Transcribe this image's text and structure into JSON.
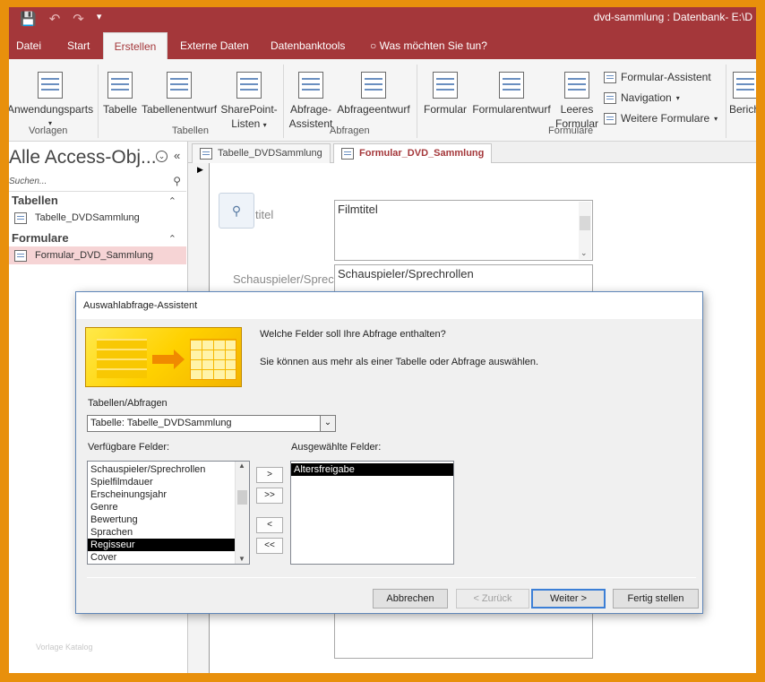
{
  "window": {
    "title": "dvd-sammlung : Datenbank- E:\\D"
  },
  "ribbon_tabs": [
    {
      "label": "Datei"
    },
    {
      "label": "Start"
    },
    {
      "label": "Erstellen"
    },
    {
      "label": "Externe Daten"
    },
    {
      "label": "Datenbanktools"
    },
    {
      "label": "Was möchten Sie tun?"
    }
  ],
  "ribbon": {
    "groups": {
      "vorlagen": "Vorlagen",
      "tabellen": "Tabellen",
      "abfragen": "Abfragen",
      "formulare": "Formulare"
    },
    "buttons": {
      "anwendungsparts": "Anwendungsparts",
      "tabelle": "Tabelle",
      "tabellenentwurf": "Tabellenentwurf",
      "sharepoint_1": "SharePoint-",
      "sharepoint_2": "Listen",
      "abfrage_assistent_1": "Abfrage-",
      "abfrage_assistent_2": "Assistent",
      "abfrageentwurf": "Abfrageentwurf",
      "formular": "Formular",
      "formularentwurf": "Formularentwurf",
      "leeres_formular_1": "Leeres",
      "leeres_formular_2": "Formular",
      "formular_assistent": "Formular-Assistent",
      "navigation": "Navigation",
      "weitere_formulare": "Weitere Formulare",
      "bericht": "Berich"
    }
  },
  "nav": {
    "title": "Alle Access-Obj...",
    "search_placeholder": "Suchen...",
    "groups": [
      {
        "label": "Tabellen",
        "items": [
          "Tabelle_DVDSammlung"
        ]
      },
      {
        "label": "Formulare",
        "items": [
          "Formular_DVD_Sammlung"
        ]
      }
    ],
    "footer": "Vorlage Katalog"
  },
  "doc_tabs": [
    {
      "label": "Tabelle_DVDSammlung"
    },
    {
      "label": "Formular_DVD_Sammlung"
    }
  ],
  "form": {
    "field1_label": "titel",
    "field1_value": "Filmtitel",
    "field2_label": "Schauspieler/Sprec",
    "field2_value": "Schauspieler/Sprechrollen"
  },
  "dialog": {
    "title": "Auswahlabfrage-Assistent",
    "question": "Welche Felder soll Ihre Abfrage enthalten?",
    "hint": "Sie können aus mehr als einer Tabelle oder Abfrage auswählen.",
    "tables_label": "Tabellen/Abfragen",
    "tables_value": "Tabelle: Tabelle_DVDSammlung",
    "available_label": "Verfügbare Felder:",
    "selected_label": "Ausgewählte Felder:",
    "available_fields": [
      "Schauspieler/Sprechrollen",
      "Spielfilmdauer",
      "Erscheinungsjahr",
      "Genre",
      "Bewertung",
      "Sprachen",
      "Regisseur",
      "Cover"
    ],
    "selected_available_index": 6,
    "selected_fields": [
      "Altersfreigabe"
    ],
    "move_buttons": [
      ">",
      ">>",
      "<",
      "<<"
    ],
    "buttons": {
      "cancel": "Abbrechen",
      "back": "< Zurück",
      "next": "Weiter >",
      "finish": "Fertig stellen"
    }
  },
  "colors": {
    "access_red": "#a4373a",
    "frame_orange": "#e8900c",
    "selection": "#000000"
  }
}
